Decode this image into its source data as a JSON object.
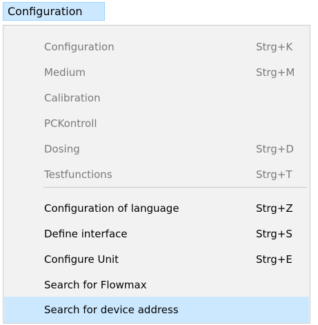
{
  "menubar": {
    "title": "Configuration"
  },
  "menu": {
    "items": [
      {
        "label": "Configuration",
        "shortcut": "Strg+K",
        "enabled": false
      },
      {
        "label": "Medium",
        "shortcut": "Strg+M",
        "enabled": false
      },
      {
        "label": "Calibration",
        "shortcut": "",
        "enabled": false
      },
      {
        "label": "PCKontroll",
        "shortcut": "",
        "enabled": false
      },
      {
        "label": "Dosing",
        "shortcut": "Strg+D",
        "enabled": false
      },
      {
        "label": "Testfunctions",
        "shortcut": "Strg+T",
        "enabled": false
      },
      {
        "label": "Configuration of language",
        "shortcut": "Strg+Z",
        "enabled": true
      },
      {
        "label": "Define interface",
        "shortcut": "Strg+S",
        "enabled": true
      },
      {
        "label": "Configure Unit",
        "shortcut": "Strg+E",
        "enabled": true
      },
      {
        "label": "Search for Flowmax",
        "shortcut": "",
        "enabled": true
      },
      {
        "label": "Search for device address",
        "shortcut": "",
        "enabled": true,
        "highlighted": true
      }
    ]
  },
  "colors": {
    "highlight": "#cce8ff",
    "highlight_border": "#99d1ff",
    "menu_background": "#f2f2f2",
    "disabled_text": "#7a7a7a",
    "enabled_text": "#000000"
  }
}
